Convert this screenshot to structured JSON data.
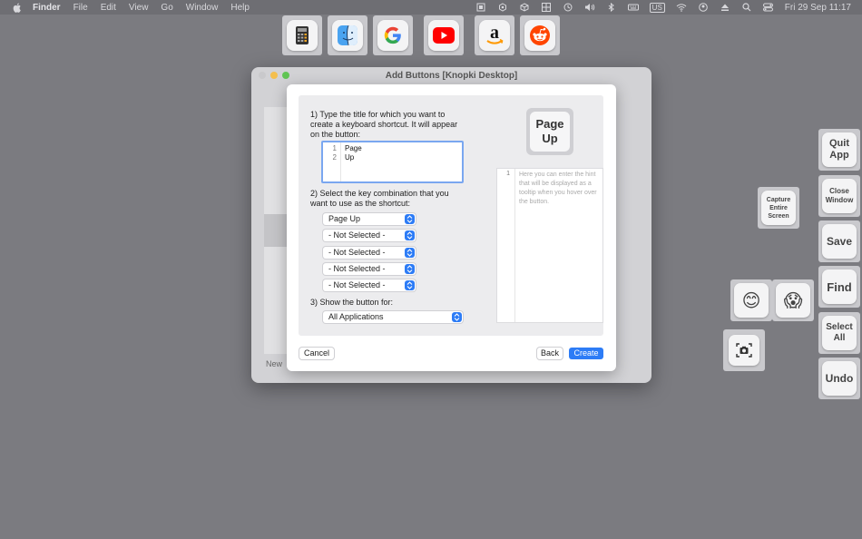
{
  "menubar": {
    "items": [
      "Finder",
      "File",
      "Edit",
      "View",
      "Go",
      "Window",
      "Help"
    ],
    "language": "US",
    "clock": "Fri 29 Sep  11:17"
  },
  "app_strip": [
    {
      "name": "calculator-icon"
    },
    {
      "name": "finder-icon"
    },
    {
      "name": "google-icon"
    },
    {
      "name": "youtube-icon"
    },
    {
      "name": "amazon-icon"
    },
    {
      "name": "reddit-icon"
    }
  ],
  "window": {
    "title": "Add Buttons [Knopki Desktop]",
    "new_label": "New"
  },
  "sheet": {
    "step1": "1) Type the title for which you want to create a keyboard shortcut. It will appear on the button:",
    "editor_lines": [
      "1",
      "2"
    ],
    "editor_text": [
      "Page",
      "Up"
    ],
    "step2": "2) Select the key combination that you want to use as the shortcut:",
    "keys": [
      "Page Up",
      "- Not Selected -",
      "- Not Selected -",
      "- Not Selected -",
      "- Not Selected -"
    ],
    "step3": "3) Show the button for:",
    "show_for": "All Applications",
    "preview": [
      "Page",
      "Up"
    ],
    "hint_line": "1",
    "hint_placeholder": "Here you can enter the hint that will be displayed as a tooltip when you hover over the button.",
    "cancel": "Cancel",
    "back": "Back",
    "create": "Create"
  },
  "desktop_buttons": {
    "quit_app": "Quit App",
    "close_window": "Close Window",
    "capture_screen": "Capture Entire Screen",
    "save": "Save",
    "find": "Find",
    "select_all": "Select All",
    "undo": "Undo",
    "emoji_smile": "😊",
    "emoji_scream": "😱"
  },
  "colors": {
    "accent": "#2d7cf6",
    "desktop": "#7b7b80"
  }
}
